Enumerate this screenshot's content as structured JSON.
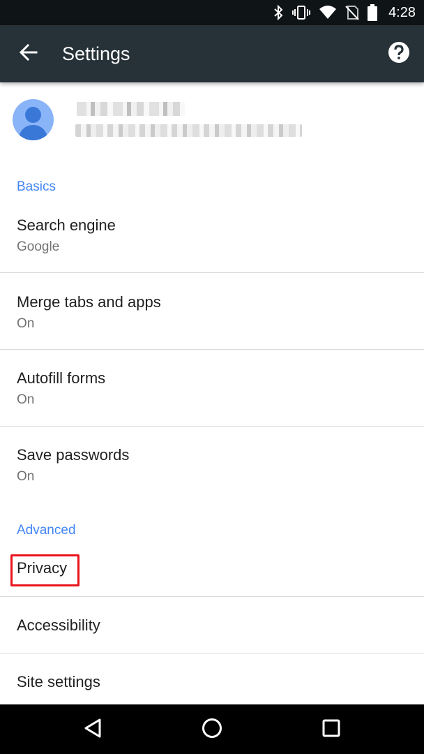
{
  "status_bar": {
    "time": "4:28",
    "icons": [
      "bluetooth-icon",
      "vibrate-icon",
      "wifi-icon",
      "no-sim-icon",
      "battery-icon"
    ]
  },
  "toolbar": {
    "title": "Settings",
    "back_icon": "arrow-back-icon",
    "help_icon": "help-icon",
    "background": "#263238"
  },
  "account": {
    "name": "",
    "email": ""
  },
  "sections": {
    "basics": "Basics",
    "advanced": "Advanced"
  },
  "items": {
    "search_engine": {
      "title": "Search engine",
      "summary": "Google"
    },
    "merge_tabs": {
      "title": "Merge tabs and apps",
      "summary": "On"
    },
    "autofill": {
      "title": "Autofill forms",
      "summary": "On"
    },
    "save_passwords": {
      "title": "Save passwords",
      "summary": "On"
    },
    "privacy": {
      "title": "Privacy"
    },
    "accessibility": {
      "title": "Accessibility"
    },
    "site_settings": {
      "title": "Site settings"
    }
  },
  "accent_color": "#4285f4",
  "highlight_color": "#e8141c",
  "nav_bar": {
    "icons": [
      "back-triangle-icon",
      "home-circle-icon",
      "recents-square-icon"
    ]
  }
}
